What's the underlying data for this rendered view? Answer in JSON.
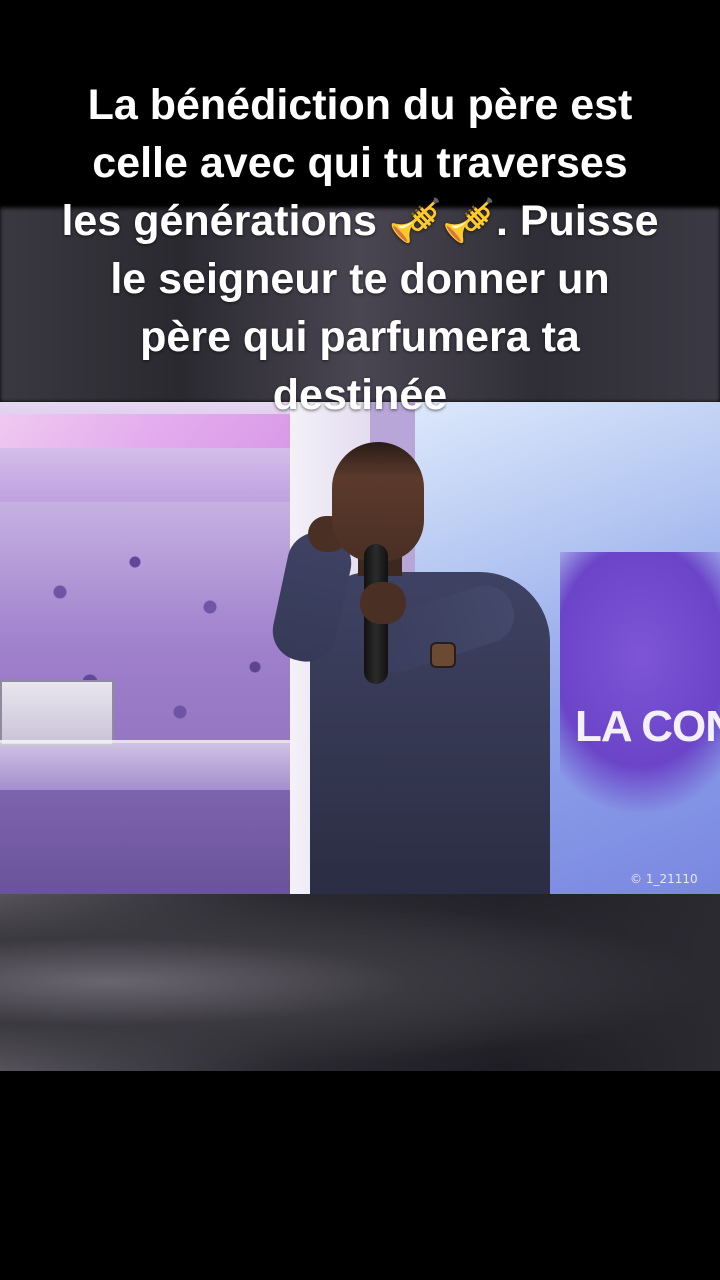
{
  "caption": {
    "line1": "La bénédiction du père est",
    "line2": "celle avec qui tu traverses",
    "line3_before": "les générations ",
    "line3_emoji": "🎺🎺",
    "line3_after": ". Puisse",
    "line4": "le seigneur te donner un",
    "line5": "père qui parfumera ta",
    "line6": "destinée"
  },
  "photo": {
    "screen_text": "LA CON",
    "watermark": "© 1_21110"
  },
  "colors": {
    "background": "#000000",
    "caption_text": "#ffffff",
    "stage_purple": "#9b79c8",
    "screen_blue": "#8ea2ea",
    "suit": "#3f4263"
  }
}
